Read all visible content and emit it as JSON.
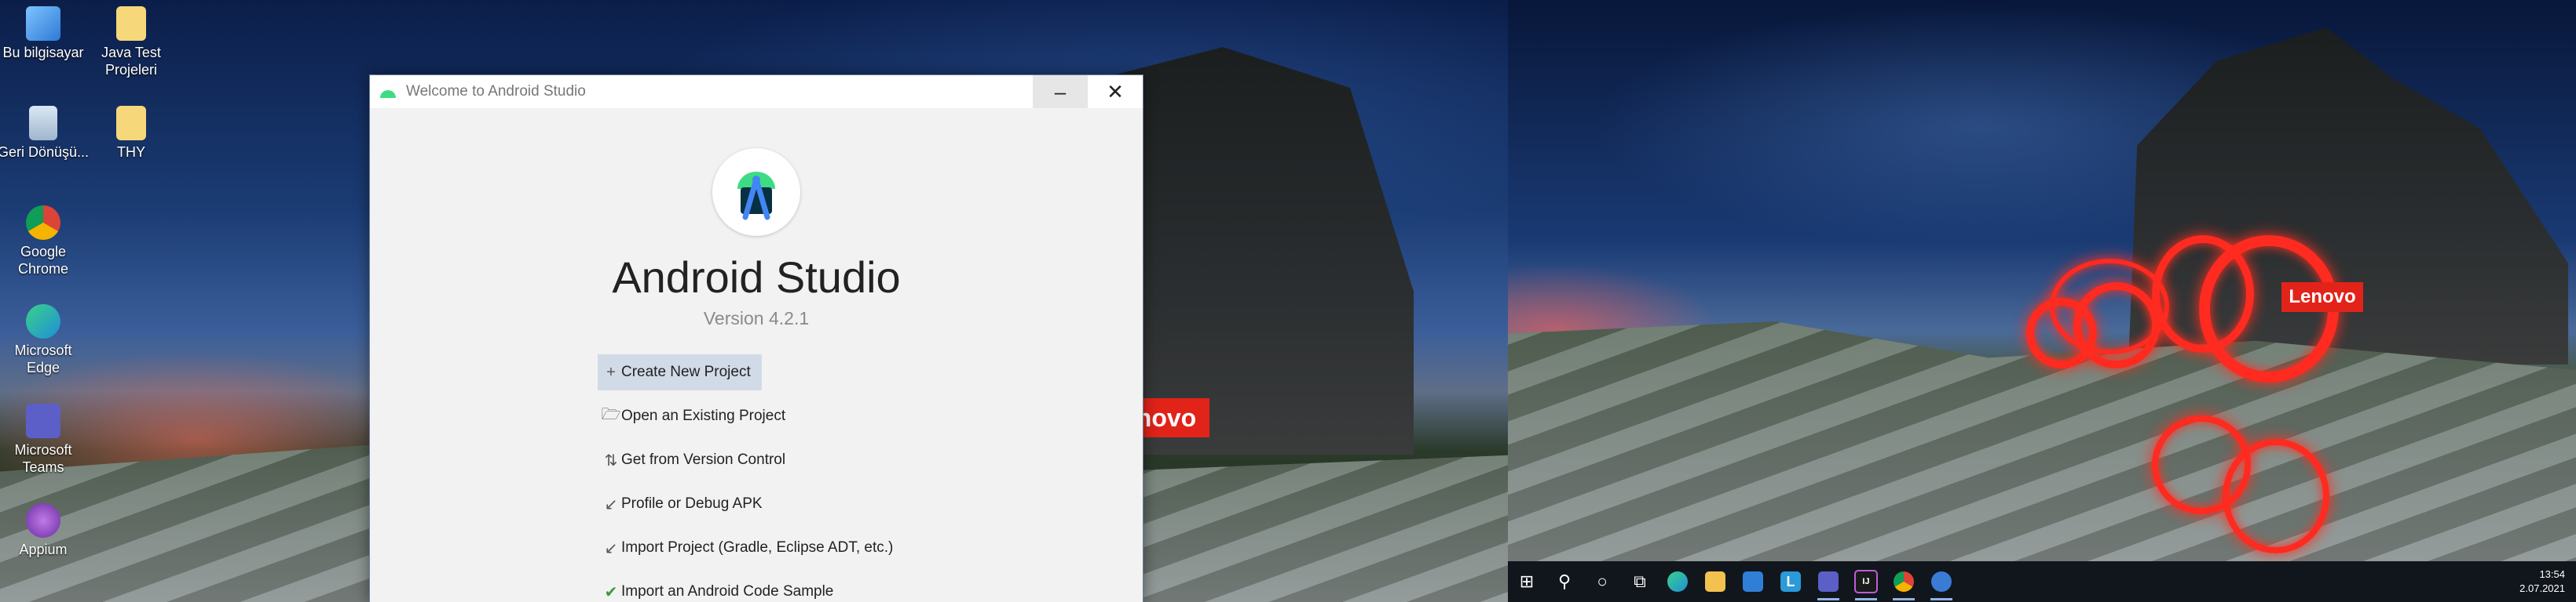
{
  "desktop_icons": [
    {
      "label": "Bu bilgisayar",
      "icon": "computer-icon"
    },
    {
      "label": "Java Test Projeleri",
      "icon": "folder-icon"
    },
    {
      "label": "Geri Dönüşü...",
      "icon": "recycle-bin-icon"
    },
    {
      "label": "THY",
      "icon": "folder-icon"
    },
    {
      "label": "Google Chrome",
      "icon": "chrome-icon"
    },
    {
      "label": "Microsoft Edge",
      "icon": "edge-icon"
    },
    {
      "label": "Microsoft Teams",
      "icon": "teams-icon"
    },
    {
      "label": "Appium",
      "icon": "appium-icon"
    }
  ],
  "wallpaper": {
    "brand_left": "novo",
    "brand_right": "Lenovo",
    "accent": "#e2231a"
  },
  "window": {
    "title": "Welcome to Android Studio",
    "app_name": "Android Studio",
    "version": "Version 4.2.1",
    "minimize_glyph": "–",
    "close_glyph": "✕",
    "actions": [
      {
        "label": "Create New Project",
        "icon": "plus-icon",
        "glyph": "+",
        "selected": true
      },
      {
        "label": "Open an Existing Project",
        "icon": "folder-open-icon",
        "glyph": "🗁",
        "selected": false
      },
      {
        "label": "Get from Version Control",
        "icon": "vcs-icon",
        "glyph": "⇅",
        "selected": false
      },
      {
        "label": "Profile or Debug APK",
        "icon": "profile-apk-icon",
        "glyph": "↙",
        "selected": false
      },
      {
        "label": "Import Project (Gradle, Eclipse ADT, etc.)",
        "icon": "import-icon",
        "glyph": "↙",
        "selected": false
      },
      {
        "label": "Import an Android Code Sample",
        "icon": "code-sample-icon",
        "glyph": "✔",
        "selected": false
      }
    ]
  },
  "taskbar": {
    "items": [
      {
        "name": "start-button",
        "glyph": "⊞"
      },
      {
        "name": "search-button",
        "glyph": "⚲"
      },
      {
        "name": "cortana-button",
        "glyph": "○"
      },
      {
        "name": "task-view-button",
        "glyph": "⧉"
      },
      {
        "name": "edge-taskbar",
        "color": "#1e8fd8"
      },
      {
        "name": "file-explorer-taskbar",
        "color": "#f2c14e"
      },
      {
        "name": "mail-taskbar",
        "color": "#2f7fd6"
      },
      {
        "name": "l-app-taskbar",
        "color": "#2a9ad8",
        "glyph": "L"
      },
      {
        "name": "teams-taskbar",
        "color": "#5b5fc7"
      },
      {
        "name": "intellij-taskbar",
        "color": "#1a1a1a",
        "glyph": "IJ"
      },
      {
        "name": "chrome-taskbar",
        "color": "#e0a325"
      },
      {
        "name": "android-studio-taskbar",
        "color": "#3a7bd5"
      }
    ],
    "time": "13:54",
    "date": "2.07.2021"
  }
}
